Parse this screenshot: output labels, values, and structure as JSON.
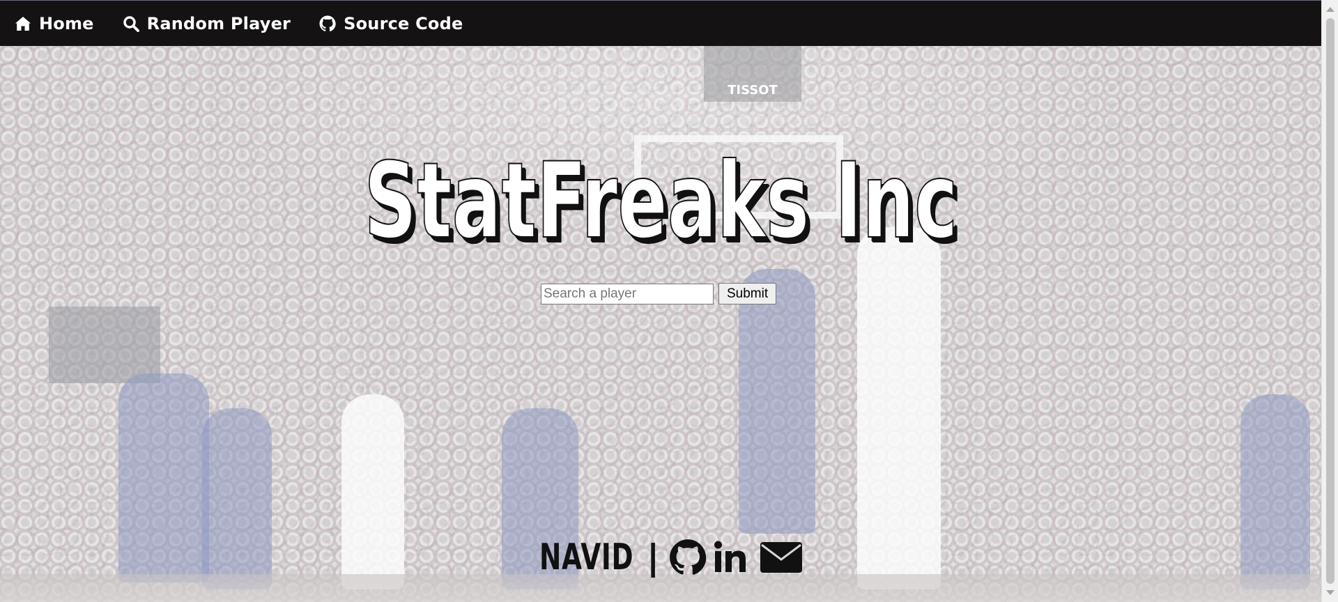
{
  "nav": {
    "items": [
      {
        "label": "Home",
        "icon": "home-icon"
      },
      {
        "label": "Random Player",
        "icon": "search-icon"
      },
      {
        "label": "Source Code",
        "icon": "github-icon"
      }
    ]
  },
  "hero": {
    "title": "StatFreaks Inc",
    "scoreboard_text": "TISSOT",
    "search": {
      "placeholder": "Search a player",
      "value": "",
      "submit_label": "Submit"
    }
  },
  "footer": {
    "name": "NAVID",
    "separator": "|",
    "links": [
      {
        "icon": "github-icon"
      },
      {
        "icon": "linkedin-icon"
      },
      {
        "icon": "envelope-icon"
      }
    ]
  },
  "colors": {
    "navbar_bg": "#141213",
    "nav_text": "#ffffff",
    "title_fill": "#ffffff",
    "title_shadow": "#111111",
    "footer_text": "#111111"
  }
}
